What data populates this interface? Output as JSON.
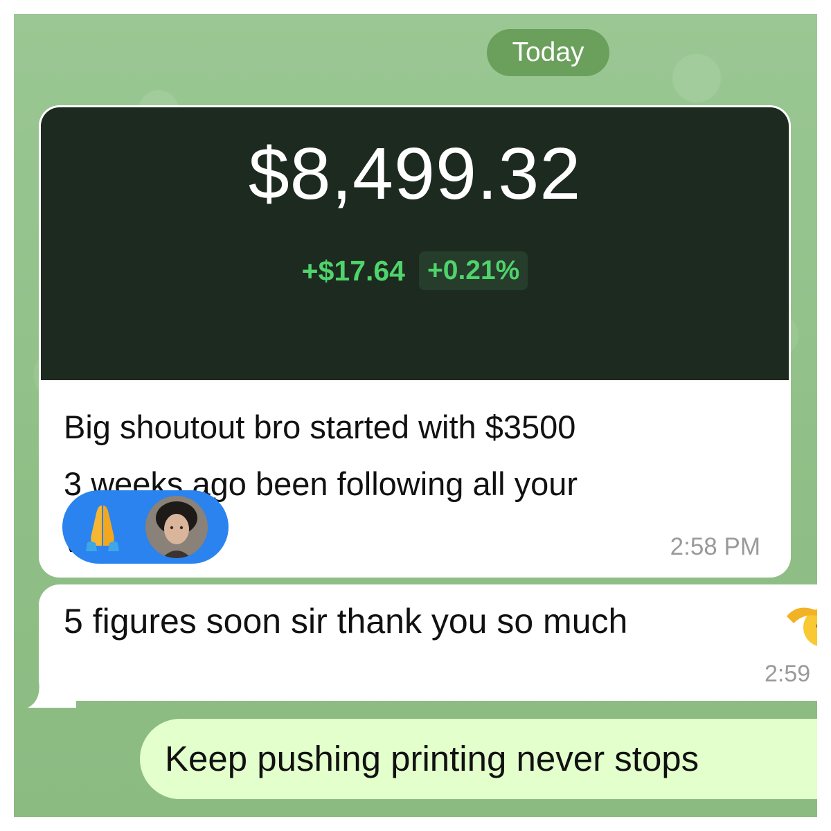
{
  "chat": {
    "date_divider": "Today",
    "messages": [
      {
        "image": {
          "balance": "$8,499.32",
          "change_amount": "+$17.64",
          "change_percent": "+0.21%"
        },
        "lines": [
          "Big shoutout bro started with $3500",
          "3 weeks ago been following all your",
          "vip calls"
        ],
        "reaction": {
          "emoji_icon": "folded-hands-emoji",
          "reactor": "avatar"
        },
        "time": "2:58 PM"
      },
      {
        "text": "5 figures soon sir thank you so much",
        "emoji_icon": "saluting-face-emoji",
        "time": "2:59"
      },
      {
        "text": "Keep pushing printing never stops",
        "outgoing": true
      }
    ]
  },
  "colors": {
    "wallpaper": "#94c28a",
    "date_pill": "#6aa05b",
    "incoming_bubble": "#ffffff",
    "outgoing_bubble": "#e2ffcc",
    "card_background": "#1d2a20",
    "gain_green": "#4fd36b",
    "reaction_blue": "#2b83ef",
    "timestamp_gray": "#9a9a9a"
  }
}
